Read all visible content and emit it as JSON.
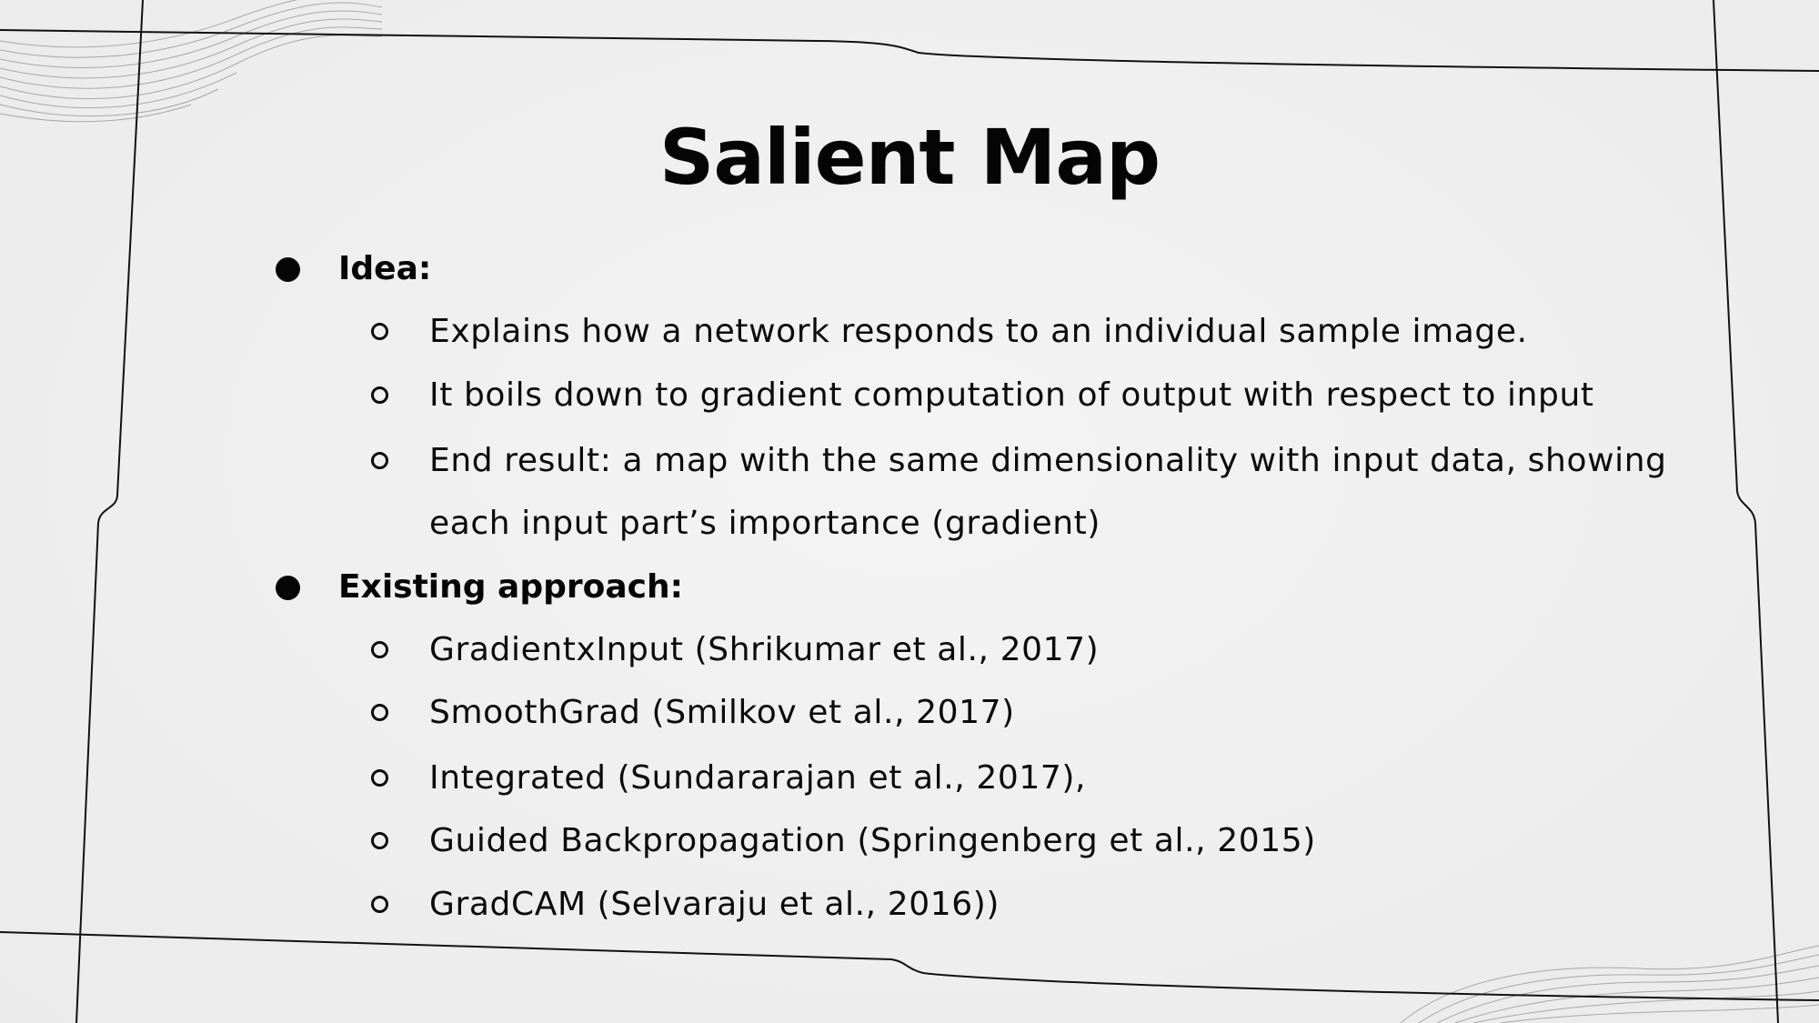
{
  "slide": {
    "title": "Salient Map",
    "sections": [
      {
        "heading": "Idea:",
        "items": [
          "Explains how a network responds to an individual sample image.",
          "It boils down to gradient computation of output with respect to input",
          "End result: a map with the same dimensionality with input data, showing",
          "each input part’s importance (gradient)"
        ]
      },
      {
        "heading": "Existing approach:",
        "items": [
          "GradientxInput (Shrikumar et al., 2017)",
          "SmoothGrad (Smilkov et al., 2017)",
          "Integrated (Sundararajan et al., 2017),",
          "Guided Backpropagation (Springenberg et al., 2015)",
          "GradCAM (Selvaraju et al., 2016))"
        ]
      }
    ]
  }
}
